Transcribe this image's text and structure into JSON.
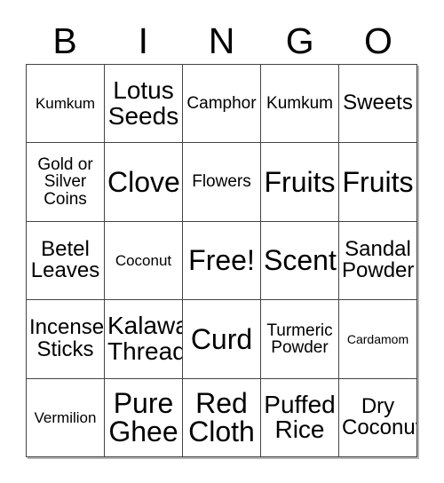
{
  "card": {
    "header_letters": [
      "B",
      "I",
      "N",
      "G",
      "O"
    ],
    "columns": 5,
    "rows": 5,
    "border_color": "#444444",
    "background_color": "#ffffff",
    "text_color": "#000000",
    "free_space_label": "Free!",
    "free_space_position": "row3-col3"
  },
  "grid": {
    "rows": [
      {
        "cells": [
          {
            "label": "Kumkum",
            "size": "s"
          },
          {
            "label": "Lotus Seeds",
            "size": "xl"
          },
          {
            "label": "Camphor",
            "size": "m"
          },
          {
            "label": "Kumkum",
            "size": "m"
          },
          {
            "label": "Sweets",
            "size": "l"
          }
        ]
      },
      {
        "cells": [
          {
            "label": "Gold or Silver Coins",
            "size": "m"
          },
          {
            "label": "Clove",
            "size": "xxl"
          },
          {
            "label": "Flowers",
            "size": "m"
          },
          {
            "label": "Fruits",
            "size": "xxl"
          },
          {
            "label": "Fruits",
            "size": "xxl"
          }
        ]
      },
      {
        "cells": [
          {
            "label": "Betel Leaves",
            "size": "l"
          },
          {
            "label": "Coconut",
            "size": "s"
          },
          {
            "label": "Free!",
            "size": "xxl"
          },
          {
            "label": "Scent",
            "size": "xxl"
          },
          {
            "label": "Sandal Powder",
            "size": "l"
          }
        ]
      },
      {
        "cells": [
          {
            "label": "Incense Sticks",
            "size": "l"
          },
          {
            "label": "Kalawa Thread",
            "size": "xl"
          },
          {
            "label": "Curd",
            "size": "xxl"
          },
          {
            "label": "Turmeric Powder",
            "size": "m"
          },
          {
            "label": "Cardamom",
            "size": "xs"
          }
        ]
      },
      {
        "cells": [
          {
            "label": "Vermilion",
            "size": "s"
          },
          {
            "label": "Pure Ghee",
            "size": "xxl"
          },
          {
            "label": "Red Cloth",
            "size": "xxl"
          },
          {
            "label": "Puffed Rice",
            "size": "xl"
          },
          {
            "label": "Dry Coconut",
            "size": "l"
          }
        ]
      }
    ]
  }
}
